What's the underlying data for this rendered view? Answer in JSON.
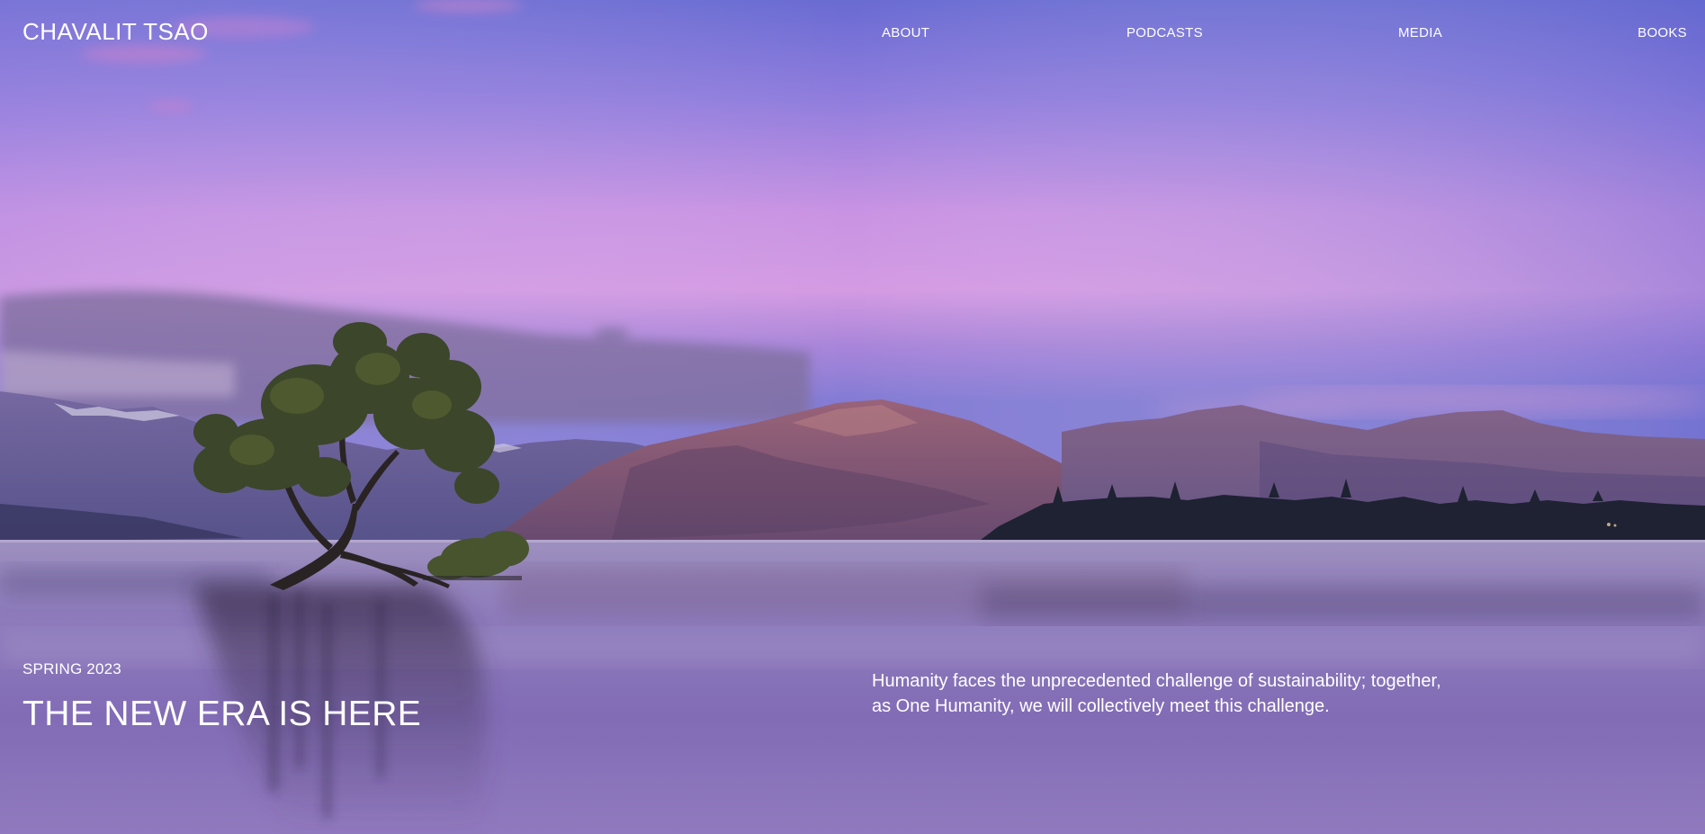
{
  "header": {
    "site_title": "CHAVALIT TSAO"
  },
  "nav": {
    "items": [
      {
        "label": "ABOUT"
      },
      {
        "label": "PODCASTS"
      },
      {
        "label": "MEDIA"
      },
      {
        "label": "BOOKS"
      }
    ]
  },
  "hero": {
    "season": "SPRING 2023",
    "headline": "THE NEW ERA IS HERE",
    "intro": "Humanity faces the unprecedented challenge of sustainability; together, as One Humanity, we will collectively meet this challenge."
  },
  "colors": {
    "sky_top": "#6f72de",
    "sky_mid": "#e0a0f0",
    "lake": "#8e79c2",
    "text": "#ffffff"
  }
}
